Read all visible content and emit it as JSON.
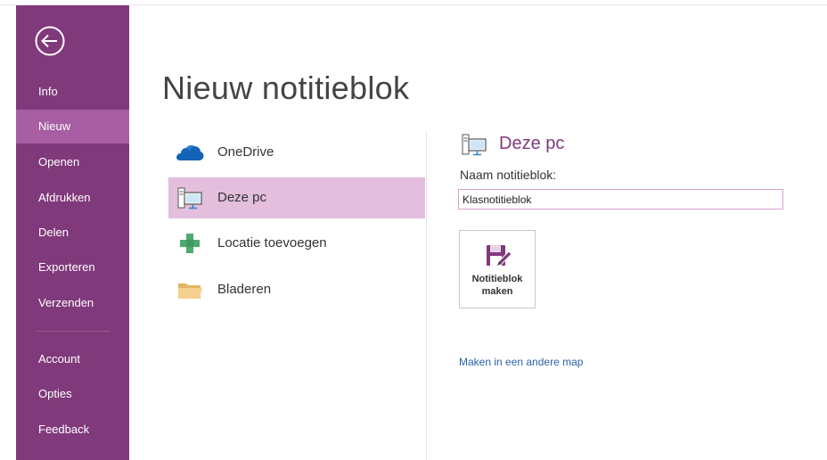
{
  "window": {
    "title": "Nieuw notitieblok"
  },
  "sidebar": {
    "back_icon": "back-arrow-circle-icon",
    "items": [
      {
        "label": "Info"
      },
      {
        "label": "Nieuw",
        "active": true
      },
      {
        "label": "Openen"
      },
      {
        "label": "Afdrukken"
      },
      {
        "label": "Delen"
      },
      {
        "label": "Exporteren"
      },
      {
        "label": "Verzenden"
      }
    ],
    "bottom_items": [
      {
        "label": "Account"
      },
      {
        "label": "Opties"
      },
      {
        "label": "Feedback"
      }
    ],
    "color": "#80397b",
    "active_color": "#a75ea3"
  },
  "locations": [
    {
      "label": "OneDrive",
      "icon": "onedrive-cloud-icon"
    },
    {
      "label": "Deze pc",
      "icon": "computer-icon",
      "active": true
    },
    {
      "label": "Locatie toevoegen",
      "icon": "plus-icon"
    },
    {
      "label": "Bladeren",
      "icon": "folder-icon"
    }
  ],
  "right_panel": {
    "title": "Deze pc",
    "title_icon": "computer-icon",
    "name_label": "Naam notitieblok:",
    "name_value": "Klasnotitieblok",
    "create_button": {
      "line1": "Notitieblok",
      "line2": "maken",
      "icon": "save-notebook-icon"
    },
    "other_folder_link": "Maken in een andere map"
  },
  "colors": {
    "accent": "#80397b",
    "selected_location": "#e3bedd",
    "link": "#2a63a8"
  }
}
